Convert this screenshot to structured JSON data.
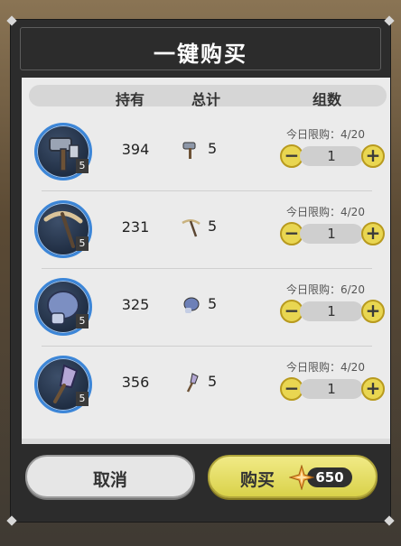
{
  "title": "一键购买",
  "headers": {
    "owned": "持有",
    "total": "总计",
    "groups": "组数"
  },
  "items": [
    {
      "icon": "hammer-icon",
      "level": "5",
      "owned": "394",
      "total": "5",
      "limit": "今日限购：4/20",
      "qty": "1"
    },
    {
      "icon": "pickaxe-icon",
      "level": "5",
      "owned": "231",
      "total": "5",
      "limit": "今日限购：4/20",
      "qty": "1"
    },
    {
      "icon": "glove-icon",
      "level": "5",
      "owned": "325",
      "total": "5",
      "limit": "今日限购：6/20",
      "qty": "1"
    },
    {
      "icon": "shovel-icon",
      "level": "5",
      "owned": "356",
      "total": "5",
      "limit": "今日限购：4/20",
      "qty": "1"
    }
  ],
  "stepper": {
    "minus": "−",
    "plus": "+"
  },
  "buttons": {
    "cancel": "取消",
    "buy": "购买",
    "price": "650"
  }
}
